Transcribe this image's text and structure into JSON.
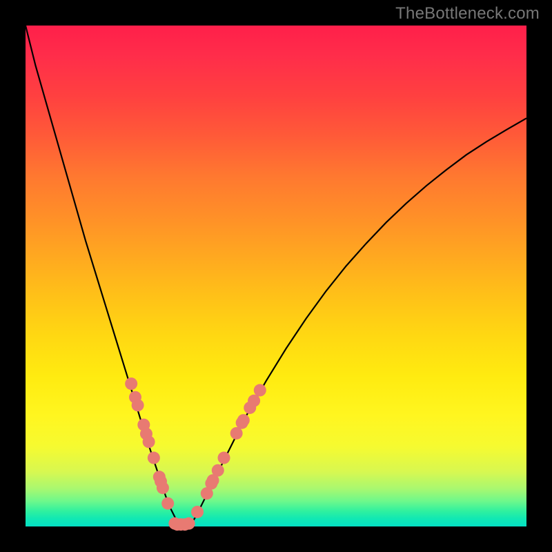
{
  "watermark_text": "TheBottleneck.com",
  "chart_data": {
    "type": "line",
    "title": "",
    "xlabel": "",
    "ylabel": "",
    "xlim": [
      0,
      100
    ],
    "ylim": [
      0,
      100
    ],
    "grid": false,
    "legend": false,
    "series": [
      {
        "name": "bottleneck-curve",
        "x": [
          0,
          2,
          4,
          6,
          8,
          10,
          12,
          14,
          16,
          18,
          20,
          22,
          24,
          26,
          27,
          28,
          29,
          30,
          31,
          32,
          33,
          34,
          36,
          38,
          40,
          44,
          48,
          52,
          56,
          60,
          64,
          68,
          72,
          76,
          80,
          84,
          88,
          92,
          96,
          100
        ],
        "y": [
          100,
          92,
          85,
          78,
          71,
          64,
          57,
          50.5,
          44,
          37.5,
          31,
          24.5,
          18,
          12,
          9,
          6,
          3.5,
          1.5,
          0.4,
          0.4,
          0.4,
          2,
          6,
          10,
          14,
          22,
          29,
          35.5,
          41.5,
          47,
          52,
          56.5,
          60.7,
          64.5,
          68,
          71.2,
          74.2,
          76.8,
          79.2,
          81.5
        ]
      }
    ],
    "annotations": {
      "dots_left": [
        {
          "x": 21.1,
          "y": 28.5
        },
        {
          "x": 21.9,
          "y": 25.8
        },
        {
          "x": 22.4,
          "y": 24.2
        },
        {
          "x": 23.6,
          "y": 20.3
        },
        {
          "x": 24.1,
          "y": 18.5
        },
        {
          "x": 24.6,
          "y": 16.9
        },
        {
          "x": 25.6,
          "y": 13.7
        },
        {
          "x": 26.7,
          "y": 9.9
        },
        {
          "x": 27.0,
          "y": 9.0
        },
        {
          "x": 27.4,
          "y": 7.7
        },
        {
          "x": 28.4,
          "y": 4.6
        }
      ],
      "dots_bottom": [
        {
          "x": 29.8,
          "y": 0.6
        },
        {
          "x": 30.3,
          "y": 0.4
        },
        {
          "x": 31.0,
          "y": 0.4
        },
        {
          "x": 31.8,
          "y": 0.4
        },
        {
          "x": 32.6,
          "y": 0.6
        }
      ],
      "dots_right": [
        {
          "x": 34.3,
          "y": 2.9
        },
        {
          "x": 36.2,
          "y": 6.6
        },
        {
          "x": 37.1,
          "y": 8.6
        },
        {
          "x": 37.4,
          "y": 9.2
        },
        {
          "x": 38.4,
          "y": 11.2
        },
        {
          "x": 39.6,
          "y": 13.7
        },
        {
          "x": 42.1,
          "y": 18.6
        },
        {
          "x": 43.2,
          "y": 20.7
        },
        {
          "x": 43.5,
          "y": 21.2
        },
        {
          "x": 44.8,
          "y": 23.7
        },
        {
          "x": 45.6,
          "y": 25.1
        },
        {
          "x": 46.8,
          "y": 27.2
        }
      ]
    },
    "background_gradient": {
      "type": "vertical",
      "stops": [
        {
          "pos": 0,
          "color": "#ff1f4a"
        },
        {
          "pos": 50,
          "color": "#ffb81c"
        },
        {
          "pos": 80,
          "color": "#fff620"
        },
        {
          "pos": 100,
          "color": "#04e0c4"
        }
      ]
    }
  }
}
